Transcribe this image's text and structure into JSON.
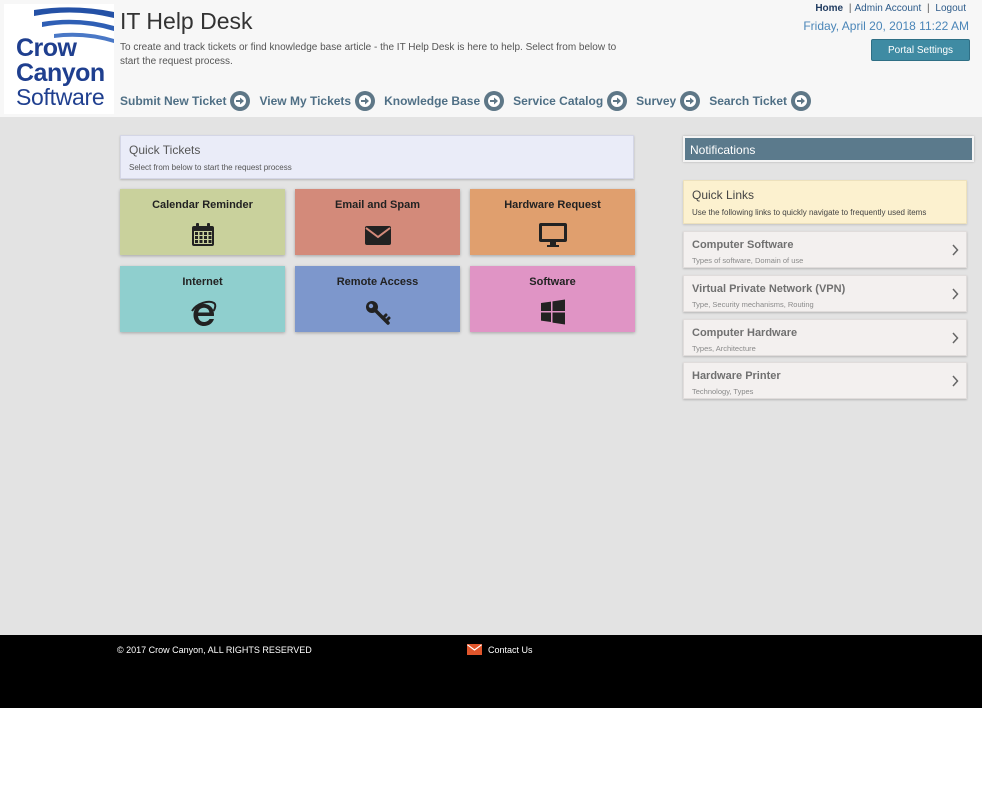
{
  "header": {
    "logo_lines": [
      "Crow",
      "Canyon",
      "Software"
    ],
    "title": "IT Help Desk",
    "intro": "To create and track tickets or find knowledge base article - the IT Help Desk is here to help. Select from below to start the request process.",
    "top_links": {
      "home": "Home",
      "sep1": "|",
      "admin": "Admin Account",
      "sep2": "|",
      "logout": "Logout"
    },
    "datetime": "Friday, April 20, 2018 11:22 AM",
    "portal_settings": "Portal Settings",
    "nav": [
      {
        "label": "Submit New Ticket",
        "icon": "arrow-right-circle-icon"
      },
      {
        "label": "View My Tickets",
        "icon": "arrow-right-circle-icon"
      },
      {
        "label": "Knowledge Base",
        "icon": "arrow-right-circle-icon"
      },
      {
        "label": "Service Catalog",
        "icon": "arrow-right-circle-icon"
      },
      {
        "label": "Survey",
        "icon": "arrow-right-circle-icon"
      },
      {
        "label": "Search Ticket",
        "icon": "arrow-right-circle-icon"
      }
    ]
  },
  "quick_tickets": {
    "title": "Quick Tickets",
    "subtitle": "Select from below to start the request process",
    "tiles": [
      {
        "label": "Calendar Reminder",
        "icon": "calendar-icon",
        "color": "#c9d19c"
      },
      {
        "label": "Email and Spam",
        "icon": "envelope-icon",
        "color": "#d38a7a"
      },
      {
        "label": "Hardware Request",
        "icon": "monitor-icon",
        "color": "#e09f6e"
      },
      {
        "label": "Internet",
        "icon": "internet-explorer-icon",
        "color": "#8fcfce"
      },
      {
        "label": "Remote Access",
        "icon": "key-icon",
        "color": "#7d97cc"
      },
      {
        "label": "Software",
        "icon": "windows-icon",
        "color": "#e094c5"
      }
    ]
  },
  "notifications": {
    "title": "Notifications"
  },
  "quick_links": {
    "title": "Quick Links",
    "subtitle": "Use the following links to quickly navigate to frequently used items",
    "items": [
      {
        "name": "Computer Software",
        "desc": "Types of software, Domain of use"
      },
      {
        "name": "Virtual Private Network (VPN)",
        "desc": "Type, Security mechanisms, Routing"
      },
      {
        "name": "Computer Hardware",
        "desc": "Types, Architecture"
      },
      {
        "name": "Hardware Printer",
        "desc": "Technology, Types"
      }
    ]
  },
  "footer": {
    "copyright": "© 2017 Crow Canyon, ALL RIGHTS RESERVED",
    "contact": "Contact Us"
  },
  "colors": {
    "header_bg": "#f7f7f7",
    "main_bg": "#e3e3e3",
    "nav_text": "#4f6f85",
    "portal_button": "#3f8ba3",
    "notifications_bar": "#5b7a8c",
    "quick_links_bg": "#fcf1cf",
    "footer_bg": "#000000"
  }
}
